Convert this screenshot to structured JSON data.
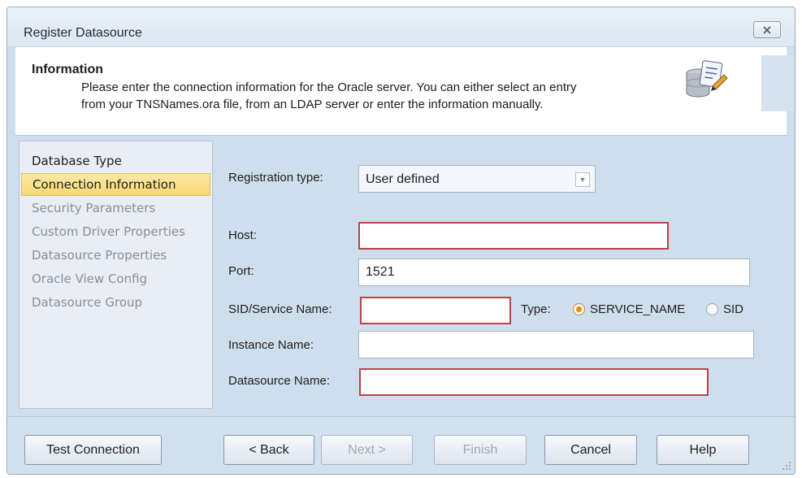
{
  "window": {
    "title": "Register Datasource",
    "close_icon": "close-x-icon"
  },
  "info": {
    "heading": "Information",
    "line1": "Please enter the connection information for the Oracle server.  You can either select an entry",
    "line2": "from your TNSNames.ora file, from an LDAP server or enter the information manually.",
    "icon": "database-register-icon"
  },
  "nav": {
    "items": [
      {
        "label": "Database Type",
        "state": "done"
      },
      {
        "label": "Connection Information",
        "state": "active"
      },
      {
        "label": "Security Parameters",
        "state": "pending"
      },
      {
        "label": "Custom Driver Properties",
        "state": "pending"
      },
      {
        "label": "Datasource Properties",
        "state": "pending"
      },
      {
        "label": "Oracle View Config",
        "state": "pending"
      },
      {
        "label": "Datasource Group",
        "state": "pending"
      }
    ]
  },
  "form": {
    "registration_type": {
      "label": "Registration type:",
      "value": "User defined"
    },
    "host": {
      "label": "Host:",
      "value": ""
    },
    "port": {
      "label": "Port:",
      "value": "1521"
    },
    "sid": {
      "label": "SID/Service Name:",
      "value": ""
    },
    "type": {
      "label": "Type:",
      "options": [
        "SERVICE_NAME",
        "SID"
      ],
      "selected": "SERVICE_NAME"
    },
    "instance_name": {
      "label": "Instance Name:",
      "value": ""
    },
    "datasource_name": {
      "label": "Datasource Name:",
      "value": ""
    }
  },
  "buttons": {
    "test_connection": "Test Connection",
    "back": "< Back",
    "next": "Next >",
    "finish": "Finish",
    "cancel": "Cancel",
    "help": "Help"
  },
  "colors": {
    "required_border": "#b8444a",
    "active_nav": "#f6d873",
    "dialog_bg": "#cfdeec"
  }
}
